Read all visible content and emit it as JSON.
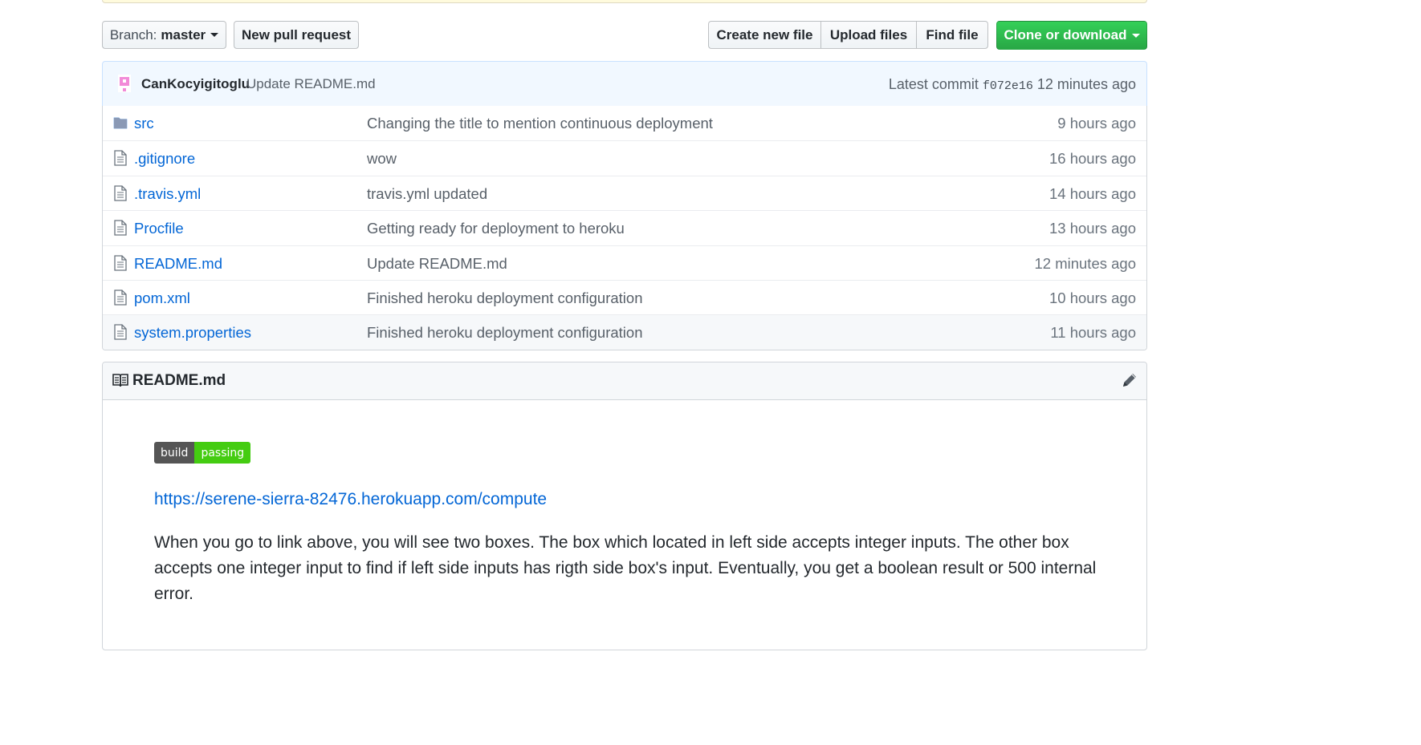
{
  "toolbar": {
    "branch_prefix": "Branch:",
    "branch_name": "master",
    "new_pull_request": "New pull request",
    "create_new_file": "Create new file",
    "upload_files": "Upload files",
    "find_file": "Find file",
    "clone_or_download": "Clone or download"
  },
  "commit": {
    "author": "CanKocyigitoglu",
    "message": "Update README.md",
    "latest_label": "Latest commit",
    "sha": "f072e16",
    "age": "12 minutes ago"
  },
  "files": [
    {
      "name": "src",
      "type": "folder",
      "message": "Changing the title to mention continuous deployment",
      "age": "9 hours ago"
    },
    {
      "name": ".gitignore",
      "type": "file",
      "message": "wow",
      "age": "16 hours ago"
    },
    {
      "name": ".travis.yml",
      "type": "file",
      "message": "travis.yml updated",
      "age": "14 hours ago"
    },
    {
      "name": "Procfile",
      "type": "file",
      "message": "Getting ready for deployment to heroku",
      "age": "13 hours ago"
    },
    {
      "name": "README.md",
      "type": "file",
      "message": "Update README.md",
      "age": "12 minutes ago"
    },
    {
      "name": "pom.xml",
      "type": "file",
      "message": "Finished heroku deployment configuration",
      "age": "10 hours ago"
    },
    {
      "name": "system.properties",
      "type": "file",
      "message": "Finished heroku deployment configuration",
      "age": "11 hours ago"
    }
  ],
  "readme": {
    "title": "README.md",
    "badge_left": "build",
    "badge_right": "passing",
    "link": "https://serene-sierra-82476.herokuapp.com/compute",
    "paragraph": "When you go to link above, you will see two boxes. The box which located in left side accepts integer inputs. The other box accepts one integer input to find if left side inputs has rigth side box's input. Eventually, you get a boolean result or 500 internal error."
  },
  "colors": {
    "link": "#0366d6",
    "clone_button": "#28a745",
    "commit_bar": "#f1f8ff",
    "badge_pass": "#44cc11"
  },
  "icons": {
    "folder": "folder-icon",
    "file": "file-icon",
    "readme": "book-icon",
    "edit": "pencil-icon"
  }
}
